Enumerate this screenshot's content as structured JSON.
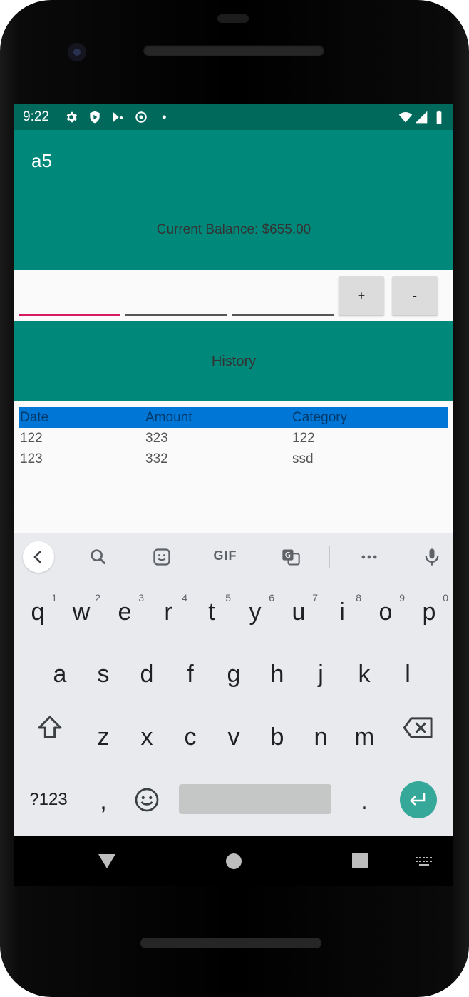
{
  "status_bar": {
    "time": "9:22"
  },
  "app": {
    "title": "a5"
  },
  "balance": {
    "text": "Current Balance: $655.00"
  },
  "inputs": {
    "field1": "",
    "field2": "",
    "field3": ""
  },
  "buttons": {
    "add": "+",
    "subtract": "-"
  },
  "history": {
    "title": "History",
    "columns": [
      "Date",
      "Amount",
      "Category"
    ],
    "rows": [
      [
        "122",
        "323",
        "122"
      ],
      [
        "123",
        "332",
        "ssd"
      ]
    ]
  },
  "keyboard": {
    "row1": [
      {
        "key": "q",
        "num": "1"
      },
      {
        "key": "w",
        "num": "2"
      },
      {
        "key": "e",
        "num": "3"
      },
      {
        "key": "r",
        "num": "4"
      },
      {
        "key": "t",
        "num": "5"
      },
      {
        "key": "y",
        "num": "6"
      },
      {
        "key": "u",
        "num": "7"
      },
      {
        "key": "i",
        "num": "8"
      },
      {
        "key": "o",
        "num": "9"
      },
      {
        "key": "p",
        "num": "0"
      }
    ],
    "row2": [
      "a",
      "s",
      "d",
      "f",
      "g",
      "h",
      "j",
      "k",
      "l"
    ],
    "row3": [
      "z",
      "x",
      "c",
      "v",
      "b",
      "n",
      "m"
    ],
    "symbols_label": "?123",
    "comma": ",",
    "period": ".",
    "gif_label": "GIF"
  },
  "colors": {
    "primary": "#00897b",
    "primary_dark": "#00695c",
    "accent": "#d81b60",
    "table_header": "#0077d6"
  }
}
